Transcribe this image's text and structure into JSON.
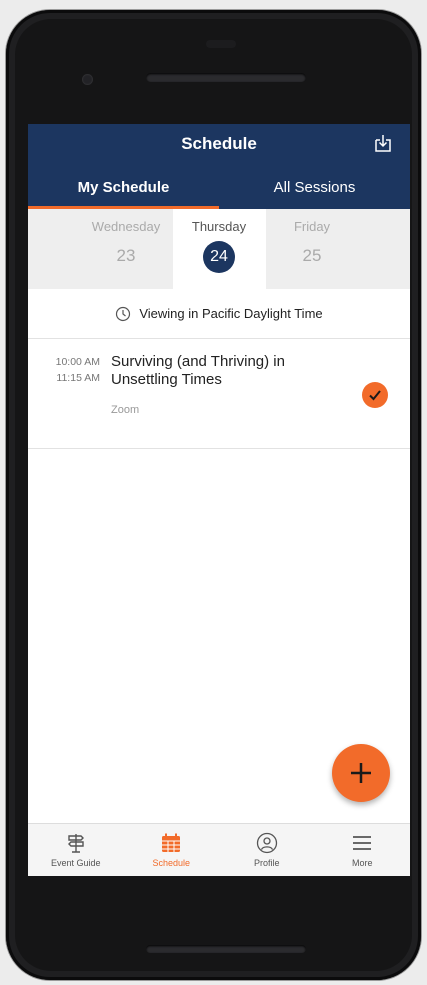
{
  "header": {
    "title": "Schedule"
  },
  "tabs": [
    {
      "label": "My Schedule",
      "active": true
    },
    {
      "label": "All Sessions",
      "active": false
    }
  ],
  "days": [
    {
      "name": "Wednesday",
      "num": "23"
    },
    {
      "name": "Thursday",
      "num": "24"
    },
    {
      "name": "Friday",
      "num": "25"
    }
  ],
  "timezone": {
    "text": "Viewing in Pacific Daylight Time"
  },
  "sessions": [
    {
      "start": "10:00 AM",
      "end": "11:15 AM",
      "title": "Surviving (and Thriving) in Unsettling Times",
      "location": "Zoom",
      "added": true
    }
  ],
  "nav": [
    {
      "label": "Event Guide",
      "icon": "signpost-icon"
    },
    {
      "label": "Schedule",
      "icon": "calendar-icon",
      "active": true
    },
    {
      "label": "Profile",
      "icon": "profile-icon"
    },
    {
      "label": "More",
      "icon": "menu-icon"
    }
  ],
  "colors": {
    "primary": "#1c3660",
    "accent": "#f26b2a",
    "background": "#ffffff"
  }
}
